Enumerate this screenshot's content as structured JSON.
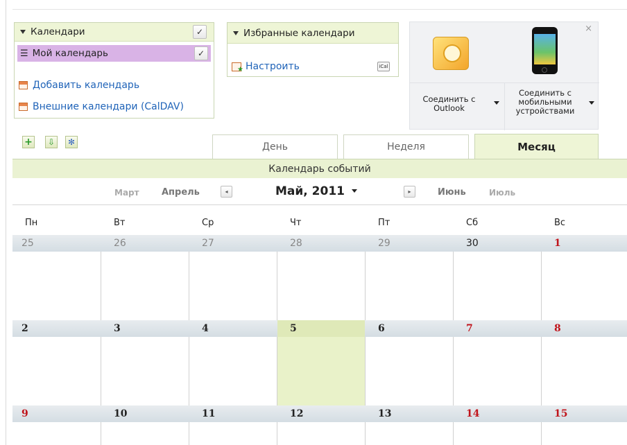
{
  "calendars_panel": {
    "title": "Календари",
    "my_calendar": "Мой календарь",
    "add_calendar": "Добавить календарь",
    "external_calendars": "Внешние календари (CalDAV)"
  },
  "favorites_panel": {
    "title": "Избранные календари",
    "configure": "Настроить"
  },
  "promo": {
    "outlook_label_1": "Соединить с",
    "outlook_label_2": "Outlook",
    "mobile_label_1": "Соединить с",
    "mobile_label_2": "мобильными",
    "mobile_label_3": "устройствами",
    "close": "×"
  },
  "toolbar": {
    "add_icon": "+",
    "export_icon": "⇩",
    "settings_icon": "✻"
  },
  "tabs": {
    "day": "День",
    "week": "Неделя",
    "month": "Месяц"
  },
  "events_title": "Календарь событий",
  "month_nav": {
    "prev2": "Март",
    "prev1": "Апрель",
    "prev_arrow": "◂",
    "current": "Май, 2011",
    "next_arrow": "▸",
    "next1": "Июнь",
    "next2": "Июль"
  },
  "weekdays": [
    "Пн",
    "Вт",
    "Ср",
    "Чт",
    "Пт",
    "Сб",
    "Вс"
  ],
  "weeks": [
    [
      "25",
      "26",
      "27",
      "28",
      "29",
      "30",
      "1"
    ],
    [
      "2",
      "3",
      "4",
      "5",
      "6",
      "7",
      "8"
    ],
    [
      "9",
      "10",
      "11",
      "12",
      "13",
      "14",
      "15"
    ]
  ],
  "colors": {
    "accent_green": "#eef5d6",
    "selected_calendar": "#d9b3e6",
    "link_blue": "#1f63b8",
    "weekend_red": "#c0141b",
    "today": "#e9f2c9"
  }
}
